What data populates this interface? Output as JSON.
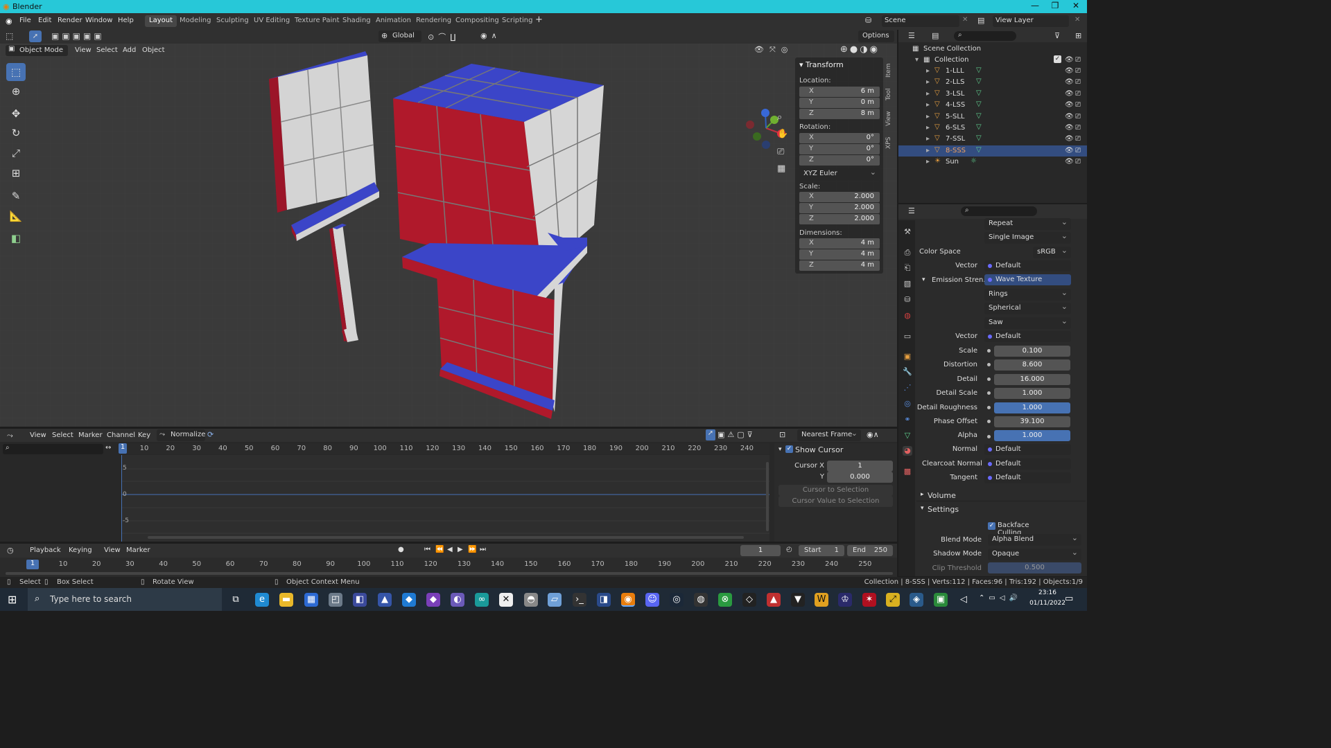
{
  "window": {
    "title": "Blender",
    "minimize": "—",
    "maximize": "❐",
    "close": "✕"
  },
  "menu": {
    "items": [
      "File",
      "Edit",
      "Render",
      "Window",
      "Help"
    ]
  },
  "workspaces": [
    "Layout",
    "Modeling",
    "Sculpting",
    "UV Editing",
    "Texture Paint",
    "Shading",
    "Animation",
    "Rendering",
    "Compositing",
    "Scripting"
  ],
  "active_workspace": "Layout",
  "scene": {
    "name": "Scene",
    "view_layer": "View Layer"
  },
  "viewport_toolbar": {
    "orientation": "Global",
    "options": "Options"
  },
  "viewport_header": {
    "mode": "Object Mode",
    "menus": [
      "View",
      "Select",
      "Add",
      "Object"
    ]
  },
  "tools": [
    "select-box",
    "cursor",
    "move",
    "rotate",
    "scale",
    "transform",
    "annotate",
    "measure",
    "add-cube"
  ],
  "sidebar_tabs": [
    "Item",
    "Tool",
    "View",
    "XPS"
  ],
  "transform": {
    "header": "Transform",
    "location_label": "Location:",
    "location": {
      "x": "6 m",
      "y": "0 m",
      "z": "8 m"
    },
    "rotation_label": "Rotation:",
    "rotation": {
      "x": "0°",
      "y": "0°",
      "z": "0°"
    },
    "rotation_mode": "XYZ Euler",
    "scale_label": "Scale:",
    "scale": {
      "x": "2.000",
      "y": "2.000",
      "z": "2.000"
    },
    "dimensions_label": "Dimensions:",
    "dimensions": {
      "x": "4 m",
      "y": "4 m",
      "z": "4 m"
    },
    "axis": {
      "x": "X",
      "y": "Y",
      "z": "Z"
    }
  },
  "outliner": {
    "root": "Scene Collection",
    "collection": "Collection",
    "objects": [
      {
        "name": "1-LLL",
        "selected": false
      },
      {
        "name": "2-LLS",
        "selected": false
      },
      {
        "name": "3-LSL",
        "selected": false
      },
      {
        "name": "4-LSS",
        "selected": false
      },
      {
        "name": "5-SLL",
        "selected": false
      },
      {
        "name": "6-SLS",
        "selected": false
      },
      {
        "name": "7-SSL",
        "selected": false
      },
      {
        "name": "8-SSS",
        "selected": true
      }
    ],
    "light": "Sun"
  },
  "properties": {
    "repeat": "Repeat",
    "single_image": "Single Image",
    "color_space_label": "Color Space",
    "color_space": "sRGB",
    "vector_label": "Vector",
    "vector_value": "Default",
    "emission_label": "Emission Stren...",
    "emission_value": "Wave Texture",
    "wave_type": "Rings",
    "wave_direction": "Spherical",
    "wave_profile": "Saw",
    "vector2_label": "Vector",
    "vector2_value": "Default",
    "numeric": [
      {
        "label": "Scale",
        "value": "0.100",
        "highlight": false
      },
      {
        "label": "Distortion",
        "value": "8.600",
        "highlight": false
      },
      {
        "label": "Detail",
        "value": "16.000",
        "highlight": false
      },
      {
        "label": "Detail Scale",
        "value": "1.000",
        "highlight": false
      },
      {
        "label": "Detail Roughness",
        "value": "1.000",
        "highlight": true
      },
      {
        "label": "Phase Offset",
        "value": "39.100",
        "highlight": false
      }
    ],
    "alpha_label": "Alpha",
    "alpha_value": "1.000",
    "normal_label": "Normal",
    "normal_value": "Default",
    "clearcoat_label": "Clearcoat Normal",
    "clearcoat_value": "Default",
    "tangent_label": "Tangent",
    "tangent_value": "Default",
    "volume": "Volume",
    "settings": "Settings",
    "backface_culling": "Backface Culling",
    "blend_mode_label": "Blend Mode",
    "blend_mode": "Alpha Blend",
    "shadow_mode_label": "Shadow Mode",
    "shadow_mode": "Opaque",
    "clip_label": "Clip Threshold",
    "clip_value": "0.500"
  },
  "graph_editor": {
    "menus": [
      "View",
      "Select",
      "Marker",
      "Channel",
      "Key"
    ],
    "normalize": "Normalize",
    "interp": "Nearest Frame",
    "ruler": [
      "10",
      "20",
      "30",
      "40",
      "50",
      "60",
      "70",
      "80",
      "90",
      "100",
      "110",
      "120",
      "130",
      "140",
      "150",
      "160",
      "170",
      "180",
      "190",
      "200",
      "210",
      "220",
      "230",
      "240"
    ],
    "current_frame": "1",
    "y_ticks": [
      "5",
      "0",
      "-5"
    ],
    "panel_title": "Show Cursor",
    "cursor_x_label": "Cursor X",
    "cursor_x": "1",
    "cursor_y_label": "Y",
    "cursor_y": "0.000",
    "btn_cursor_to_selection": "Cursor to Selection",
    "btn_cursor_value": "Cursor Value to Selection"
  },
  "timeline": {
    "menus": [
      "Playback",
      "Keying",
      "View",
      "Marker"
    ],
    "frame": "1",
    "start_label": "Start",
    "start": "1",
    "end_label": "End",
    "end": "250",
    "ruler": [
      "10",
      "20",
      "30",
      "40",
      "50",
      "60",
      "70",
      "80",
      "90",
      "100",
      "110",
      "120",
      "130",
      "140",
      "150",
      "160",
      "170",
      "180",
      "190",
      "200",
      "210",
      "220",
      "230",
      "240",
      "250"
    ],
    "current_frame": "1"
  },
  "status": {
    "select": "Select",
    "box_select": "Box Select",
    "rotate_view": "Rotate View",
    "context_menu": "Object Context Menu",
    "stats": "Collection | 8-SSS | Verts:112 | Faces:96 | Tris:192 | Objects:1/9"
  },
  "taskbar": {
    "search_placeholder": "Type here to search",
    "time": "23:16",
    "date": "01/11/2022"
  },
  "colors": {
    "accent": "#4772b3",
    "selected_row": "#334d80",
    "title": "#27c8d8",
    "cube_red": "#b0192b",
    "cube_blue": "#3b45c8",
    "cube_white": "#d6d6d6"
  }
}
